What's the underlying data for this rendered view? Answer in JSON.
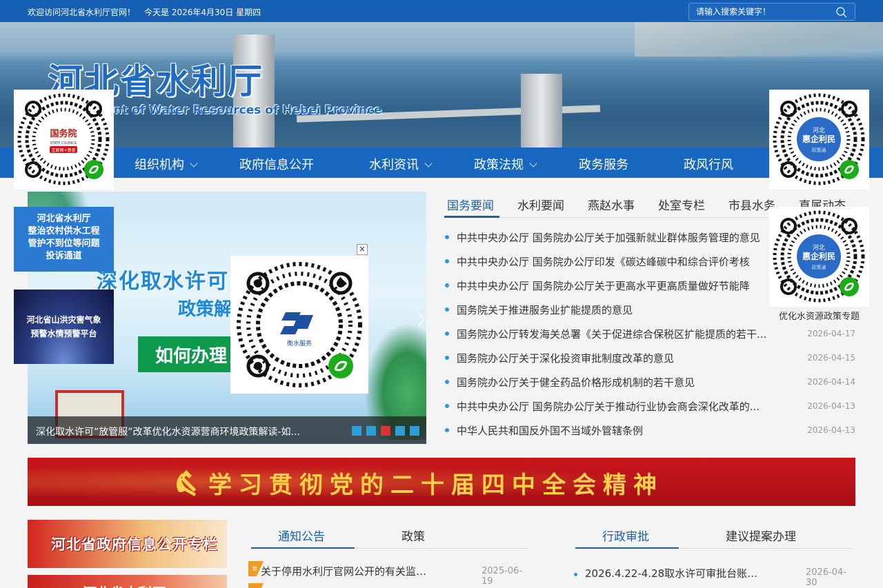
{
  "topbar": {
    "welcome": "欢迎访问河北省水利厅官网！",
    "date": "今天是 2026年4月30日 星期四",
    "search_placeholder": "请输入搜索关键字！"
  },
  "banner": {
    "title": "河北省水利厅",
    "subtitle": "Department of Water Resources of Hebei Province"
  },
  "nav": {
    "items": [
      {
        "label": "组织机构",
        "dropdown": true
      },
      {
        "label": "政府信息公开",
        "dropdown": false
      },
      {
        "label": "水利资讯",
        "dropdown": true
      },
      {
        "label": "政策法规",
        "dropdown": true
      },
      {
        "label": "政务服务",
        "dropdown": false
      },
      {
        "label": "政风行风",
        "dropdown": false
      }
    ]
  },
  "side_left": {
    "notice_lines": [
      "河北省水利厅",
      "整治农村供水工程",
      "管护不到位等问题",
      "投诉通道"
    ],
    "flood_lines": [
      "河北省山洪灾害气象",
      "预警水情预警平台"
    ]
  },
  "side_right": {
    "caption": "优化水资源政策专题"
  },
  "slider": {
    "headline": "深化取水许可“放管服”改革",
    "subhead": "政策解读",
    "howto": "如何办理",
    "caption": "深化取水许可“放管服”改革优化水资源营商环境政策解读-如...",
    "slide_count": 5,
    "active_slide": 3
  },
  "news": {
    "tabs": [
      "国务要闻",
      "水利要闻",
      "燕赵水事",
      "处室专栏",
      "市县水务",
      "直属动态"
    ],
    "active_tab": 0,
    "items": [
      {
        "title": "中共中央办公厅 国务院办公厅关于加强新就业群体服务管理的意见",
        "date": ""
      },
      {
        "title": "中共中央办公厅 国务院办公厅印发《碳达峰碳中和综合评价考核",
        "date": ""
      },
      {
        "title": "中共中央办公厅 国务院办公厅关于更高水平更高质量做好节能降",
        "date": ""
      },
      {
        "title": "国务院关于推进服务业扩能提质的意见",
        "date": ""
      },
      {
        "title": "国务院办公厅转发海关总署《关于促进综合保税区扩能提质的若干...",
        "date": "2026-04-17"
      },
      {
        "title": "国务院办公厅关于深化投资审批制度改革的意见",
        "date": "2026-04-15"
      },
      {
        "title": "国务院办公厅关于健全药品价格形成机制的若干意见",
        "date": "2026-04-14"
      },
      {
        "title": "中共中央办公厅 国务院办公厅关于推动行业协会商会深化改革的...",
        "date": "2026-04-13"
      },
      {
        "title": "中华人民共和国反外国不当域外管辖条例",
        "date": "2026-04-13"
      }
    ]
  },
  "party_banner": {
    "slogan": "学习贯彻党的二十届四中全会精神"
  },
  "promos": {
    "gov_info": "河北省政府信息公开专栏",
    "second": "河北省水利厅"
  },
  "notices": {
    "tabs": [
      "通知公告",
      "政策"
    ],
    "items": [
      {
        "title": "关于停用水利厅官网公开的有关监…",
        "date": "2025-06-19",
        "badge": "新"
      }
    ]
  },
  "approvals": {
    "tabs": [
      "行政审批",
      "建议提案办理"
    ],
    "items": [
      {
        "title": "2026.4.22-4.28取水许可审批台账…",
        "date": "2026-04-30"
      }
    ]
  },
  "qr_labels": {
    "left": "国务院",
    "left_sub": "互联网+督查",
    "left_en": "STATE COUNCIL",
    "right_top": "河北",
    "right_main": "惠企利民",
    "right_sub": "政策通",
    "popup_brand": "衡水服务"
  },
  "colors": {
    "primary": "#1766bf",
    "topbar": "#1560b4",
    "accent_blue": "#1a5fa8",
    "bullet": "#2e97d8",
    "party_red": "#c8161c",
    "party_gold": "#ffd24a"
  }
}
